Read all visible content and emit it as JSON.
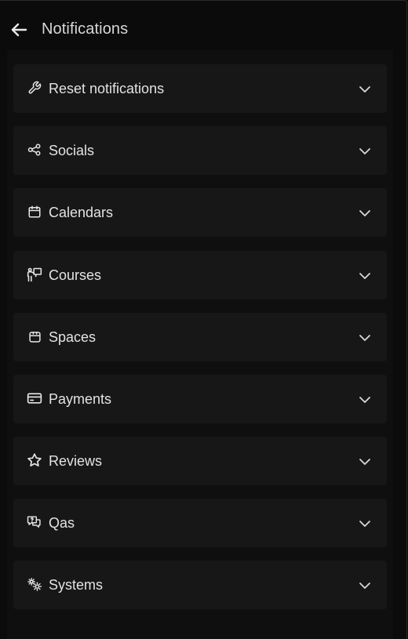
{
  "header": {
    "title": "Notifications",
    "back_icon": "arrow-left-icon"
  },
  "sections": [
    {
      "label": "Reset notifications",
      "icon": "wrench-icon"
    },
    {
      "label": "Socials",
      "icon": "share-nodes-icon"
    },
    {
      "label": "Calendars",
      "icon": "calendar-icon"
    },
    {
      "label": "Courses",
      "icon": "teacher-board-icon"
    },
    {
      "label": "Spaces",
      "icon": "space-box-icon"
    },
    {
      "label": "Payments",
      "icon": "credit-card-icon"
    },
    {
      "label": "Reviews",
      "icon": "star-icon"
    },
    {
      "label": "Qas",
      "icon": "chat-question-icon"
    },
    {
      "label": "Systems",
      "icon": "gears-icon"
    }
  ],
  "colors": {
    "background": "#0b0b0b",
    "panel": "#0f0f0f",
    "item": "#171717",
    "text": "#e3e3e3"
  }
}
